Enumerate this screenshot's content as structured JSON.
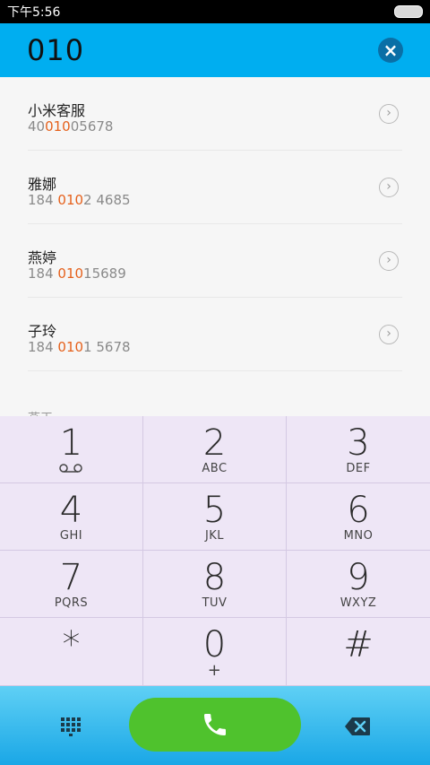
{
  "status": {
    "time": "下午5:56"
  },
  "header": {
    "dialed_number": "010"
  },
  "results": [
    {
      "name": "小米客服",
      "pre": "40",
      "match": "010",
      "post": "05678"
    },
    {
      "name": "雅娜",
      "pre": "184 ",
      "match": "010",
      "post": "2 4685"
    },
    {
      "name": "燕婷",
      "pre": "184 ",
      "match": "010",
      "post": "15689"
    },
    {
      "name": "子玲",
      "pre": "184 ",
      "match": "010",
      "post": "1 5678"
    }
  ],
  "partial_label": "燕王",
  "keypad": [
    {
      "digit": "1",
      "letters": ""
    },
    {
      "digit": "2",
      "letters": "ABC"
    },
    {
      "digit": "3",
      "letters": "DEF"
    },
    {
      "digit": "4",
      "letters": "GHI"
    },
    {
      "digit": "5",
      "letters": "JKL"
    },
    {
      "digit": "6",
      "letters": "MNO"
    },
    {
      "digit": "7",
      "letters": "PQRS"
    },
    {
      "digit": "8",
      "letters": "TUV"
    },
    {
      "digit": "9",
      "letters": "WXYZ"
    },
    {
      "digit": "*",
      "letters": ""
    },
    {
      "digit": "0",
      "letters": "+"
    },
    {
      "digit": "#",
      "letters": ""
    }
  ],
  "colors": {
    "header": "#00aef0",
    "highlight": "#e5611c",
    "call": "#4fc22d",
    "keypad_bg": "#eee6f6"
  }
}
